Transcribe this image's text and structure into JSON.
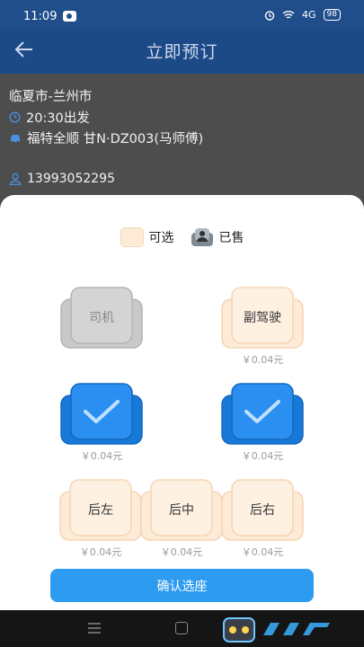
{
  "status_bar": {
    "time": "11:09",
    "signal": "4G",
    "battery": "98"
  },
  "header": {
    "title": "立即预订",
    "back_icon": "arrow-left-icon"
  },
  "trip": {
    "route": "临夏市-兰州市",
    "departure": "20:30出发",
    "vehicle": "福特全顺 甘N·DZ003(马师傅)",
    "phone": "13993052295"
  },
  "legend": {
    "available": "可选",
    "sold": "已售"
  },
  "seats": [
    {
      "label": "司机",
      "state": "driver",
      "price": ""
    },
    {
      "label": "副驾驶",
      "state": "available",
      "price": "￥0.04元"
    },
    {
      "label": "",
      "state": "selected",
      "price": "￥0.04元"
    },
    {
      "label": "",
      "state": "selected",
      "price": "￥0.04元"
    },
    {
      "label": "后左",
      "state": "available",
      "price": "￥0.04元"
    },
    {
      "label": "后中",
      "state": "available",
      "price": "￥0.04元"
    },
    {
      "label": "后右",
      "state": "available",
      "price": "￥0.04元"
    }
  ],
  "confirm_label": "确认选座",
  "colors": {
    "primary": "#2d9bef",
    "header": "#1c4a86",
    "available": "#fdebd8",
    "selected": "#1e88e5",
    "driver": "#cfcfcf"
  }
}
